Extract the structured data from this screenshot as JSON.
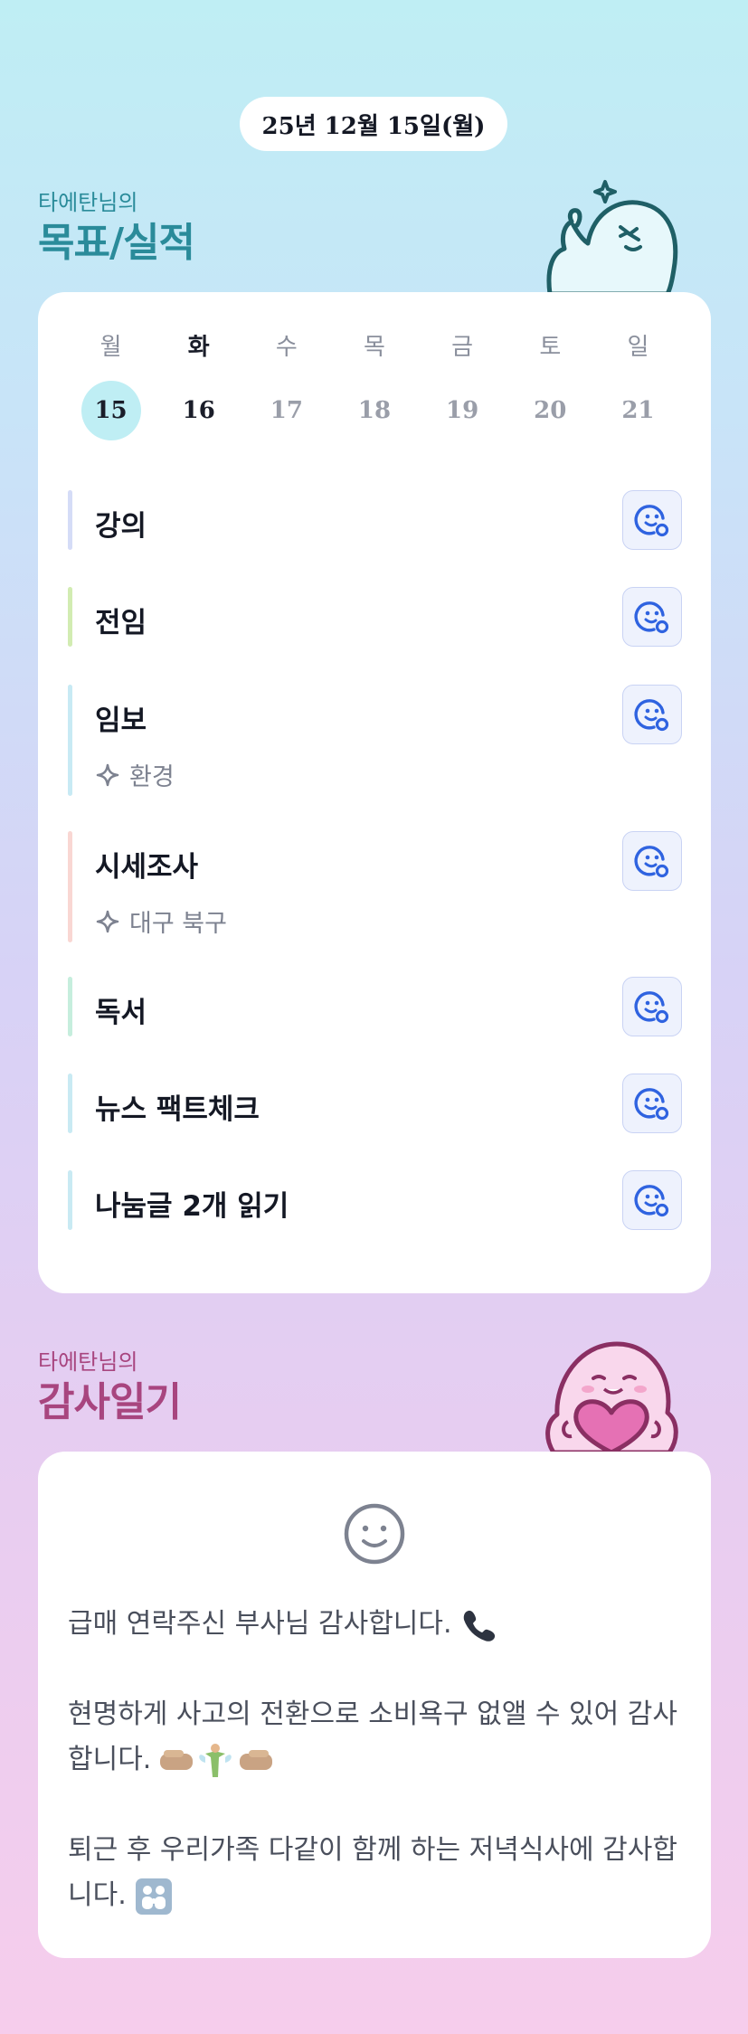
{
  "header": {
    "date": "25년 12월 15일(월)"
  },
  "goals_section": {
    "owner": "타에탄님의",
    "title": "목표/실적"
  },
  "week": {
    "days": [
      {
        "label": "월",
        "num": "15",
        "selected": true,
        "today": false
      },
      {
        "label": "화",
        "num": "16",
        "selected": false,
        "today": true
      },
      {
        "label": "수",
        "num": "17",
        "selected": false,
        "today": false
      },
      {
        "label": "목",
        "num": "18",
        "selected": false,
        "today": false
      },
      {
        "label": "금",
        "num": "19",
        "selected": false,
        "today": false
      },
      {
        "label": "토",
        "num": "20",
        "selected": false,
        "today": false
      },
      {
        "label": "일",
        "num": "21",
        "selected": false,
        "today": false
      }
    ]
  },
  "tasks": [
    {
      "name": "강의",
      "sub": "",
      "color": "#d5dcf7"
    },
    {
      "name": "전임",
      "sub": "",
      "color": "#d2ecb2"
    },
    {
      "name": "임보",
      "sub": "환경",
      "color": "#c8eaf4"
    },
    {
      "name": "시세조사",
      "sub": "대구 북구",
      "color": "#f9d7d3"
    },
    {
      "name": "독서",
      "sub": "",
      "color": "#c6eedd"
    },
    {
      "name": "뉴스 팩트체크",
      "sub": "",
      "color": "#c9eaf3"
    },
    {
      "name": "나눔글 2개 읽기",
      "sub": "",
      "color": "#c9eaf3"
    }
  ],
  "gratitude_section": {
    "owner": "타에탄님의",
    "title": "감사일기"
  },
  "gratitude": {
    "entries": [
      {
        "text": "급매 연락주신 부사님 감사합니다.",
        "emoji": "phone-icon"
      },
      {
        "text": "현명하게 사고의 전환으로 소비욕구 없앨 수 있어 감사합니다.",
        "emoji": "fist-fairy-fist-icon"
      },
      {
        "text": "퇴근 후 우리가족 다같이 함께 하는 저녁식사에 감사합니다.",
        "emoji": "family-icon"
      }
    ]
  },
  "colors": {
    "accent_blue": "#2f63e0",
    "goal_title": "#2a8b9a",
    "gratitude_title": "#a8457f",
    "selected_day": "#bfeef4"
  }
}
